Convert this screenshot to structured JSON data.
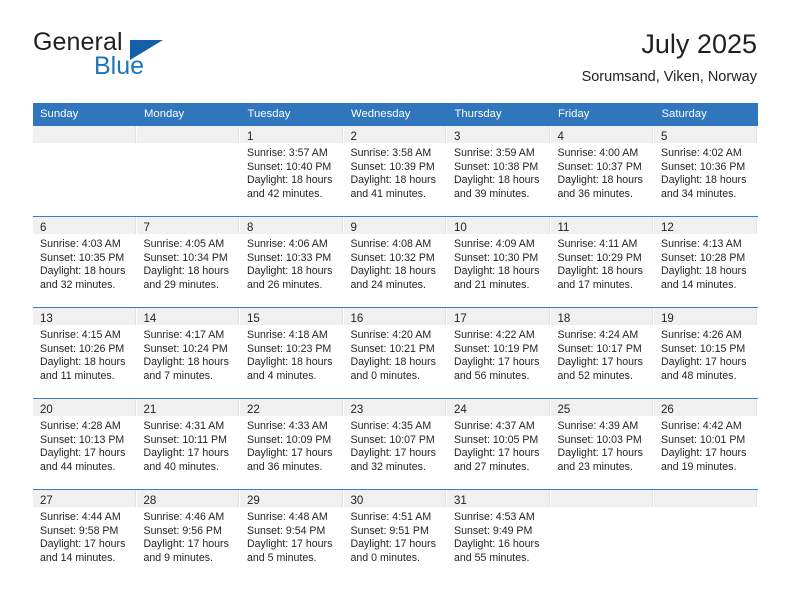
{
  "brand": {
    "name_top": "General",
    "name_bottom": "Blue",
    "flag_color": "#1261a8",
    "blue_color": "#1b75bb"
  },
  "header": {
    "title": "July 2025",
    "location": "Sorumsand, Viken, Norway"
  },
  "theme": {
    "header_bg": "#2f76bc",
    "daynum_bg": "#f0f0f0",
    "row_rule": "#3b7ec0",
    "text": "#231f20"
  },
  "weekday_headers": [
    "Sunday",
    "Monday",
    "Tuesday",
    "Wednesday",
    "Thursday",
    "Friday",
    "Saturday"
  ],
  "weeks": [
    [
      {
        "day": "",
        "sunrise": "",
        "sunset": "",
        "daylight_1": "",
        "daylight_2": ""
      },
      {
        "day": "",
        "sunrise": "",
        "sunset": "",
        "daylight_1": "",
        "daylight_2": ""
      },
      {
        "day": "1",
        "sunrise": "Sunrise: 3:57 AM",
        "sunset": "Sunset: 10:40 PM",
        "daylight_1": "Daylight: 18 hours",
        "daylight_2": "and 42 minutes."
      },
      {
        "day": "2",
        "sunrise": "Sunrise: 3:58 AM",
        "sunset": "Sunset: 10:39 PM",
        "daylight_1": "Daylight: 18 hours",
        "daylight_2": "and 41 minutes."
      },
      {
        "day": "3",
        "sunrise": "Sunrise: 3:59 AM",
        "sunset": "Sunset: 10:38 PM",
        "daylight_1": "Daylight: 18 hours",
        "daylight_2": "and 39 minutes."
      },
      {
        "day": "4",
        "sunrise": "Sunrise: 4:00 AM",
        "sunset": "Sunset: 10:37 PM",
        "daylight_1": "Daylight: 18 hours",
        "daylight_2": "and 36 minutes."
      },
      {
        "day": "5",
        "sunrise": "Sunrise: 4:02 AM",
        "sunset": "Sunset: 10:36 PM",
        "daylight_1": "Daylight: 18 hours",
        "daylight_2": "and 34 minutes."
      }
    ],
    [
      {
        "day": "6",
        "sunrise": "Sunrise: 4:03 AM",
        "sunset": "Sunset: 10:35 PM",
        "daylight_1": "Daylight: 18 hours",
        "daylight_2": "and 32 minutes."
      },
      {
        "day": "7",
        "sunrise": "Sunrise: 4:05 AM",
        "sunset": "Sunset: 10:34 PM",
        "daylight_1": "Daylight: 18 hours",
        "daylight_2": "and 29 minutes."
      },
      {
        "day": "8",
        "sunrise": "Sunrise: 4:06 AM",
        "sunset": "Sunset: 10:33 PM",
        "daylight_1": "Daylight: 18 hours",
        "daylight_2": "and 26 minutes."
      },
      {
        "day": "9",
        "sunrise": "Sunrise: 4:08 AM",
        "sunset": "Sunset: 10:32 PM",
        "daylight_1": "Daylight: 18 hours",
        "daylight_2": "and 24 minutes."
      },
      {
        "day": "10",
        "sunrise": "Sunrise: 4:09 AM",
        "sunset": "Sunset: 10:30 PM",
        "daylight_1": "Daylight: 18 hours",
        "daylight_2": "and 21 minutes."
      },
      {
        "day": "11",
        "sunrise": "Sunrise: 4:11 AM",
        "sunset": "Sunset: 10:29 PM",
        "daylight_1": "Daylight: 18 hours",
        "daylight_2": "and 17 minutes."
      },
      {
        "day": "12",
        "sunrise": "Sunrise: 4:13 AM",
        "sunset": "Sunset: 10:28 PM",
        "daylight_1": "Daylight: 18 hours",
        "daylight_2": "and 14 minutes."
      }
    ],
    [
      {
        "day": "13",
        "sunrise": "Sunrise: 4:15 AM",
        "sunset": "Sunset: 10:26 PM",
        "daylight_1": "Daylight: 18 hours",
        "daylight_2": "and 11 minutes."
      },
      {
        "day": "14",
        "sunrise": "Sunrise: 4:17 AM",
        "sunset": "Sunset: 10:24 PM",
        "daylight_1": "Daylight: 18 hours",
        "daylight_2": "and 7 minutes."
      },
      {
        "day": "15",
        "sunrise": "Sunrise: 4:18 AM",
        "sunset": "Sunset: 10:23 PM",
        "daylight_1": "Daylight: 18 hours",
        "daylight_2": "and 4 minutes."
      },
      {
        "day": "16",
        "sunrise": "Sunrise: 4:20 AM",
        "sunset": "Sunset: 10:21 PM",
        "daylight_1": "Daylight: 18 hours",
        "daylight_2": "and 0 minutes."
      },
      {
        "day": "17",
        "sunrise": "Sunrise: 4:22 AM",
        "sunset": "Sunset: 10:19 PM",
        "daylight_1": "Daylight: 17 hours",
        "daylight_2": "and 56 minutes."
      },
      {
        "day": "18",
        "sunrise": "Sunrise: 4:24 AM",
        "sunset": "Sunset: 10:17 PM",
        "daylight_1": "Daylight: 17 hours",
        "daylight_2": "and 52 minutes."
      },
      {
        "day": "19",
        "sunrise": "Sunrise: 4:26 AM",
        "sunset": "Sunset: 10:15 PM",
        "daylight_1": "Daylight: 17 hours",
        "daylight_2": "and 48 minutes."
      }
    ],
    [
      {
        "day": "20",
        "sunrise": "Sunrise: 4:28 AM",
        "sunset": "Sunset: 10:13 PM",
        "daylight_1": "Daylight: 17 hours",
        "daylight_2": "and 44 minutes."
      },
      {
        "day": "21",
        "sunrise": "Sunrise: 4:31 AM",
        "sunset": "Sunset: 10:11 PM",
        "daylight_1": "Daylight: 17 hours",
        "daylight_2": "and 40 minutes."
      },
      {
        "day": "22",
        "sunrise": "Sunrise: 4:33 AM",
        "sunset": "Sunset: 10:09 PM",
        "daylight_1": "Daylight: 17 hours",
        "daylight_2": "and 36 minutes."
      },
      {
        "day": "23",
        "sunrise": "Sunrise: 4:35 AM",
        "sunset": "Sunset: 10:07 PM",
        "daylight_1": "Daylight: 17 hours",
        "daylight_2": "and 32 minutes."
      },
      {
        "day": "24",
        "sunrise": "Sunrise: 4:37 AM",
        "sunset": "Sunset: 10:05 PM",
        "daylight_1": "Daylight: 17 hours",
        "daylight_2": "and 27 minutes."
      },
      {
        "day": "25",
        "sunrise": "Sunrise: 4:39 AM",
        "sunset": "Sunset: 10:03 PM",
        "daylight_1": "Daylight: 17 hours",
        "daylight_2": "and 23 minutes."
      },
      {
        "day": "26",
        "sunrise": "Sunrise: 4:42 AM",
        "sunset": "Sunset: 10:01 PM",
        "daylight_1": "Daylight: 17 hours",
        "daylight_2": "and 19 minutes."
      }
    ],
    [
      {
        "day": "27",
        "sunrise": "Sunrise: 4:44 AM",
        "sunset": "Sunset: 9:58 PM",
        "daylight_1": "Daylight: 17 hours",
        "daylight_2": "and 14 minutes."
      },
      {
        "day": "28",
        "sunrise": "Sunrise: 4:46 AM",
        "sunset": "Sunset: 9:56 PM",
        "daylight_1": "Daylight: 17 hours",
        "daylight_2": "and 9 minutes."
      },
      {
        "day": "29",
        "sunrise": "Sunrise: 4:48 AM",
        "sunset": "Sunset: 9:54 PM",
        "daylight_1": "Daylight: 17 hours",
        "daylight_2": "and 5 minutes."
      },
      {
        "day": "30",
        "sunrise": "Sunrise: 4:51 AM",
        "sunset": "Sunset: 9:51 PM",
        "daylight_1": "Daylight: 17 hours",
        "daylight_2": "and 0 minutes."
      },
      {
        "day": "31",
        "sunrise": "Sunrise: 4:53 AM",
        "sunset": "Sunset: 9:49 PM",
        "daylight_1": "Daylight: 16 hours",
        "daylight_2": "and 55 minutes."
      },
      {
        "day": "",
        "sunrise": "",
        "sunset": "",
        "daylight_1": "",
        "daylight_2": ""
      },
      {
        "day": "",
        "sunrise": "",
        "sunset": "",
        "daylight_1": "",
        "daylight_2": ""
      }
    ]
  ]
}
